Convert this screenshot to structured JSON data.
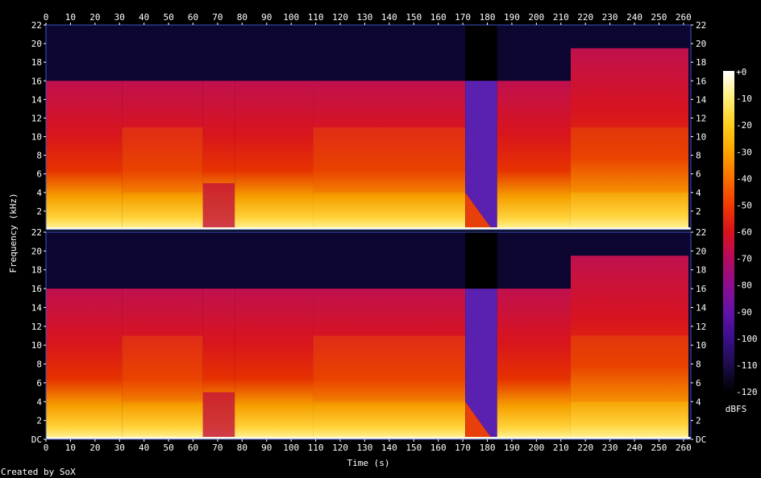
{
  "chart_data": {
    "type": "heatmap",
    "title": "",
    "xlabel": "Time (s)",
    "ylabel": "Frequency (kHz)",
    "footer": "Created by SoX",
    "x_range": [
      0,
      263
    ],
    "x_ticks": [
      0,
      10,
      20,
      30,
      40,
      50,
      60,
      70,
      80,
      90,
      100,
      110,
      120,
      130,
      140,
      150,
      160,
      170,
      180,
      190,
      200,
      210,
      220,
      230,
      240,
      250,
      260
    ],
    "channels": [
      {
        "y_range_khz": [
          0,
          22
        ],
        "y_tick_labels": [
          "2",
          "4",
          "6",
          "8",
          "10",
          "12",
          "14",
          "16",
          "18",
          "20",
          "22"
        ],
        "y_tick_values": [
          2,
          4,
          6,
          8,
          10,
          12,
          14,
          16,
          18,
          20,
          22
        ]
      },
      {
        "y_range_khz": [
          0,
          22
        ],
        "y_tick_labels": [
          "DC",
          "2",
          "4",
          "6",
          "8",
          "10",
          "12",
          "14",
          "16",
          "18",
          "20",
          "22"
        ],
        "y_tick_values": [
          0,
          2,
          4,
          6,
          8,
          10,
          12,
          14,
          16,
          18,
          20,
          22
        ]
      }
    ],
    "colorbar": {
      "label": "dBFS",
      "range": [
        -120,
        0
      ],
      "ticks": [
        "+0",
        "-10",
        "-20",
        "-30",
        "-40",
        "-50",
        "-60",
        "-70",
        "-80",
        "-90",
        "-100",
        "-110",
        "-120"
      ],
      "colors": [
        "#000000",
        "#1c0d4a",
        "#3a0f8a",
        "#6412a8",
        "#8d0e90",
        "#b50a5c",
        "#d9121c",
        "#f23a00",
        "#fb7000",
        "#ffa300",
        "#ffcf1c",
        "#ffee7a",
        "#ffffff"
      ]
    },
    "segments": [
      {
        "t": [
          0,
          31
        ],
        "lowpass_khz": 16,
        "level": "loud"
      },
      {
        "t": [
          31,
          64
        ],
        "lowpass_khz": 16,
        "level": "very loud"
      },
      {
        "t": [
          64,
          77
        ],
        "lowpass_khz": 16,
        "level": "quiet bass dip"
      },
      {
        "t": [
          77,
          109
        ],
        "lowpass_khz": 16,
        "level": "loud"
      },
      {
        "t": [
          109,
          171
        ],
        "lowpass_khz": 16,
        "level": "very loud"
      },
      {
        "t": [
          171,
          184
        ],
        "lowpass_khz": 0,
        "level": "fade"
      },
      {
        "t": [
          184,
          214
        ],
        "lowpass_khz": 16,
        "level": "loud"
      },
      {
        "t": [
          214,
          262
        ],
        "lowpass_khz": 19.5,
        "level": "very loud"
      }
    ]
  }
}
